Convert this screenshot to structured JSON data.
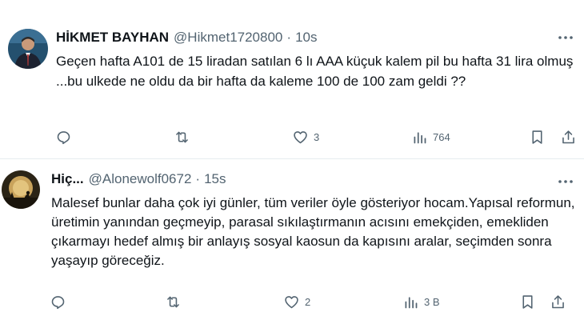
{
  "tweets": [
    {
      "name": "HİKMET BAYHAN",
      "handle": "@Hikmet1720800",
      "dot": "·",
      "time": "10s",
      "text": "Geçen hafta A101 de 15 liradan satılan 6 lı AAA küçuk kalem pil bu hafta 31 lira olmuş ...bu ulkede ne oldu da bir hafta da kaleme 100 de 100 zam geldi ??",
      "likes": "3",
      "views": "764",
      "icons": [
        "reply-icon",
        "retweet-icon",
        "like-icon",
        "views-icon",
        "bookmark-icon",
        "share-icon",
        "more-icon"
      ]
    },
    {
      "name": "Hiç...",
      "handle": "@Alonewolf0672",
      "dot": "·",
      "time": "15s",
      "text": "Malesef bunlar daha çok iyi günler, tüm veriler öyle gösteriyor hocam.Yapısal reformun, üretimin yanından geçmeyip, parasal sıkılaştırmanın acısını emekçiden, emekliden çıkarmayı hedef almış bir anlayış sosyal kaosun da kapısını aralar, seçimden sonra yaşayıp göreceğiz.",
      "likes": "2",
      "views": "3 B",
      "icons": [
        "reply-icon",
        "retweet-icon",
        "like-icon",
        "views-icon",
        "bookmark-icon",
        "share-icon",
        "more-icon"
      ]
    }
  ],
  "colors": {
    "text": "#0f1419",
    "muted": "#536471",
    "divider": "#e6ecf0"
  }
}
